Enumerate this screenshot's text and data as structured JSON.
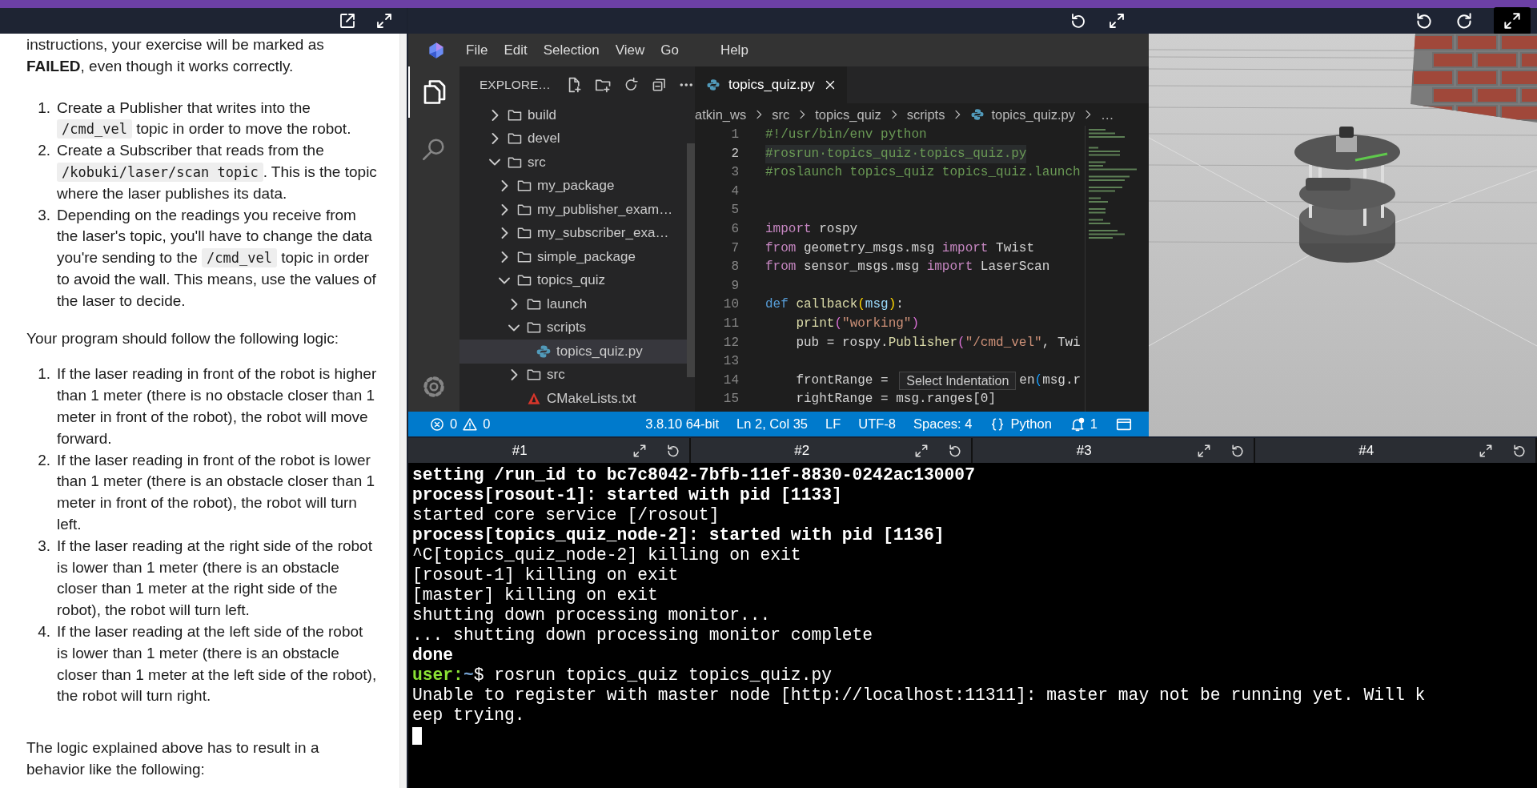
{
  "instructions_panel": {
    "intro": "instructions, your exercise will be marked as **FAILED**, even though it works correctly.",
    "steps": [
      {
        "number": "1.",
        "segments": [
          {
            "kind": "text",
            "text": "Create a Publisher that writes into the "
          },
          {
            "kind": "code",
            "text": "/cmd_vel"
          },
          {
            "kind": "text",
            "text": " topic in order to move the robot."
          }
        ]
      },
      {
        "number": "2.",
        "segments": [
          {
            "kind": "text",
            "text": "Create a Subscriber that reads from the "
          },
          {
            "kind": "code",
            "text": "/kobuki/laser/scan topic"
          },
          {
            "kind": "text",
            "text": ". This is the topic where the laser publishes its data."
          }
        ]
      },
      {
        "number": "3.",
        "segments": [
          {
            "kind": "text",
            "text": "Depending on the readings you receive from the laser's topic, you'll have to change the data you're sending to the "
          },
          {
            "kind": "code",
            "text": "/cmd_vel"
          },
          {
            "kind": "text",
            "text": " topic in order to avoid the wall. This means, use the values of the laser to decide."
          }
        ]
      }
    ],
    "logic_intro": "Your program should follow the following logic:",
    "rules": [
      {
        "number": "1.",
        "text": "If the laser reading in front of the robot is higher than 1 meter (there is no obstacle closer than 1 meter in front of the robot), the robot will move forward."
      },
      {
        "number": "2.",
        "text": "If the laser reading in front of the robot is lower than 1 meter (there is an obstacle closer than 1 meter in front of the robot), the robot will turn left."
      },
      {
        "number": "3.",
        "text": "If the laser reading at the right side of the robot is lower than 1 meter (there is an obstacle closer than 1 meter at the right side of the robot), the robot will turn left."
      },
      {
        "number": "4.",
        "text": "If the laser reading at the left side of the robot is lower than 1 meter (there is an obstacle closer than 1 meter at the left side of the robot), the robot will turn right."
      }
    ],
    "closing": "The logic explained above has to result in a behavior like the following:"
  },
  "vscode": {
    "menu": [
      "File",
      "Edit",
      "Selection",
      "View",
      "Go",
      "Help"
    ],
    "explorer": {
      "title": "EXPLORE…",
      "tree": [
        {
          "label": "build",
          "kind": "folder",
          "expanded": false,
          "selected": false
        },
        {
          "label": "devel",
          "kind": "folder",
          "expanded": false,
          "selected": false
        },
        {
          "label": "src",
          "kind": "folder",
          "expanded": true,
          "selected": false,
          "children": [
            {
              "label": "my_package",
              "kind": "folder",
              "expanded": false,
              "selected": false
            },
            {
              "label": "my_publisher_exam…",
              "kind": "folder",
              "expanded": false,
              "selected": false
            },
            {
              "label": "my_subscriber_exa…",
              "kind": "folder",
              "expanded": false,
              "selected": false
            },
            {
              "label": "simple_package",
              "kind": "folder",
              "expanded": false,
              "selected": false
            },
            {
              "label": "topics_quiz",
              "kind": "folder",
              "expanded": true,
              "selected": false,
              "children": [
                {
                  "label": "launch",
                  "kind": "folder",
                  "expanded": false,
                  "selected": false
                },
                {
                  "label": "scripts",
                  "kind": "folder",
                  "expanded": true,
                  "selected": false,
                  "children": [
                    {
                      "label": "topics_quiz.py",
                      "kind": "python",
                      "selected": true
                    }
                  ]
                },
                {
                  "label": "src",
                  "kind": "folder",
                  "expanded": false,
                  "selected": false
                },
                {
                  "label": "CMakeLists.txt",
                  "kind": "cmake",
                  "selected": false
                }
              ]
            }
          ]
        }
      ]
    },
    "editor": {
      "tabs": [
        {
          "label": "topics_quiz.py",
          "selected": true
        }
      ],
      "breadcrumb": [
        {
          "label": "atkin_ws",
          "kind": "folder"
        },
        {
          "label": "src",
          "kind": "folder"
        },
        {
          "label": "topics_quiz",
          "kind": "folder"
        },
        {
          "label": "scripts",
          "kind": "folder"
        },
        {
          "label": "topics_quiz.py",
          "kind": "python"
        },
        {
          "label": "…",
          "kind": "more"
        }
      ],
      "lines": [
        {
          "number": "1",
          "current": false,
          "tokens": [
            {
              "kind": "comment",
              "text": "#!/usr/bin/env python"
            }
          ]
        },
        {
          "number": "2",
          "current": true,
          "tokens": [
            {
              "kind": "comment",
              "text": "#rosrun·topics_quiz·topics_quiz.py"
            }
          ]
        },
        {
          "number": "3",
          "current": false,
          "tokens": [
            {
              "kind": "comment",
              "text": "#roslaunch topics_quiz topics_quiz.launch"
            }
          ]
        },
        {
          "number": "4",
          "current": false
        },
        {
          "number": "5",
          "current": false
        },
        {
          "number": "6",
          "current": false,
          "tokens": [
            {
              "kind": "keyword",
              "text": "import"
            },
            {
              "kind": "plain",
              "text": " rospy"
            }
          ]
        },
        {
          "number": "7",
          "current": false,
          "tokens": [
            {
              "kind": "keyword",
              "text": "from"
            },
            {
              "kind": "plain",
              "text": " geometry_msgs.msg "
            },
            {
              "kind": "keyword",
              "text": "import"
            },
            {
              "kind": "plain",
              "text": " Twist"
            }
          ]
        },
        {
          "number": "8",
          "current": false,
          "tokens": [
            {
              "kind": "keyword",
              "text": "from"
            },
            {
              "kind": "plain",
              "text": " sensor_msgs.msg "
            },
            {
              "kind": "keyword",
              "text": "import"
            },
            {
              "kind": "plain",
              "text": " LaserScan"
            }
          ]
        },
        {
          "number": "9",
          "current": false
        },
        {
          "number": "10",
          "current": false,
          "tokens": [
            {
              "kind": "storage",
              "text": "def"
            },
            {
              "kind": "function",
              "text": " callback"
            },
            {
              "kind": "bracket",
              "text": "("
            },
            {
              "kind": "param",
              "text": "msg"
            },
            {
              "kind": "bracket",
              "text": ")"
            },
            {
              "kind": "plain",
              "text": ":"
            }
          ]
        },
        {
          "number": "11",
          "current": false,
          "tokens": [
            {
              "kind": "function",
              "text": "    print"
            },
            {
              "kind": "bracket2",
              "text": "("
            },
            {
              "kind": "string",
              "text": "\"working\""
            },
            {
              "kind": "bracket2",
              "text": ")"
            }
          ]
        },
        {
          "number": "12",
          "current": false,
          "tokens": [
            {
              "kind": "plain",
              "text": "    pub = rospy."
            },
            {
              "kind": "function",
              "text": "Publisher"
            },
            {
              "kind": "bracket2",
              "text": "("
            },
            {
              "kind": "string",
              "text": "\"/cmd_vel\""
            },
            {
              "kind": "plain",
              "text": ", Twi"
            }
          ]
        },
        {
          "number": "13",
          "current": false
        },
        {
          "number": "14",
          "current": false,
          "tokens": [
            {
              "kind": "plain",
              "text": "    frontRange = "
            },
            {
              "kind": "tooltip",
              "text": "Select Indentation"
            },
            {
              "kind": "plain",
              "text": "en"
            },
            {
              "kind": "bracket3",
              "text": "("
            },
            {
              "kind": "plain",
              "text": "msg.r"
            }
          ]
        },
        {
          "number": "15",
          "current": false,
          "tokens": [
            {
              "kind": "plain",
              "text": "    rightRange = msg.ranges[0]"
            }
          ]
        }
      ]
    },
    "status_bar": {
      "errors": "0",
      "warnings": "0",
      "items": [
        {
          "kind": "text",
          "text": "3.8.10 64-bit"
        },
        {
          "kind": "text",
          "text": "Ln 2, Col 35"
        },
        {
          "kind": "text",
          "text": "LF"
        },
        {
          "kind": "text",
          "text": "UTF-8"
        },
        {
          "kind": "text",
          "text": "Spaces: 4"
        },
        {
          "kind": "language",
          "text": "Python"
        },
        {
          "kind": "notifications",
          "text": "1"
        },
        {
          "kind": "layout"
        }
      ]
    }
  },
  "terminal": {
    "tabs": [
      {
        "label": "#1"
      },
      {
        "label": "#2"
      },
      {
        "label": "#3"
      },
      {
        "label": "#4"
      }
    ],
    "lines": [
      {
        "kind": "bold",
        "text": "setting /run_id to bc7c8042-7bfb-11ef-8830-0242ac130007"
      },
      {
        "kind": "bold",
        "text": "process[rosout-1]: started with pid [1133]"
      },
      {
        "kind": "normal",
        "text": "started core service [/rosout]"
      },
      {
        "kind": "bold",
        "text": "process[topics_quiz_node-2]: started with pid [1136]"
      },
      {
        "kind": "normal",
        "text": "^C[topics_quiz_node-2] killing on exit"
      },
      {
        "kind": "normal",
        "text": "[rosout-1] killing on exit"
      },
      {
        "kind": "normal",
        "text": "[master] killing on exit"
      },
      {
        "kind": "normal",
        "text": "shutting down processing monitor..."
      },
      {
        "kind": "normal",
        "text": "... shutting down processing monitor complete"
      },
      {
        "kind": "bold",
        "text": "done"
      },
      {
        "kind": "prompt",
        "user": "user:",
        "path": "~",
        "symbol": "$",
        "text": " rosrun topics_quiz topics_quiz.py"
      },
      {
        "kind": "normal",
        "text": "Unable to register with master node [http://localhost:11311]: master may not be running yet. Will k"
      },
      {
        "kind": "normal",
        "text": "eep trying."
      },
      {
        "kind": "cursor"
      }
    ]
  }
}
